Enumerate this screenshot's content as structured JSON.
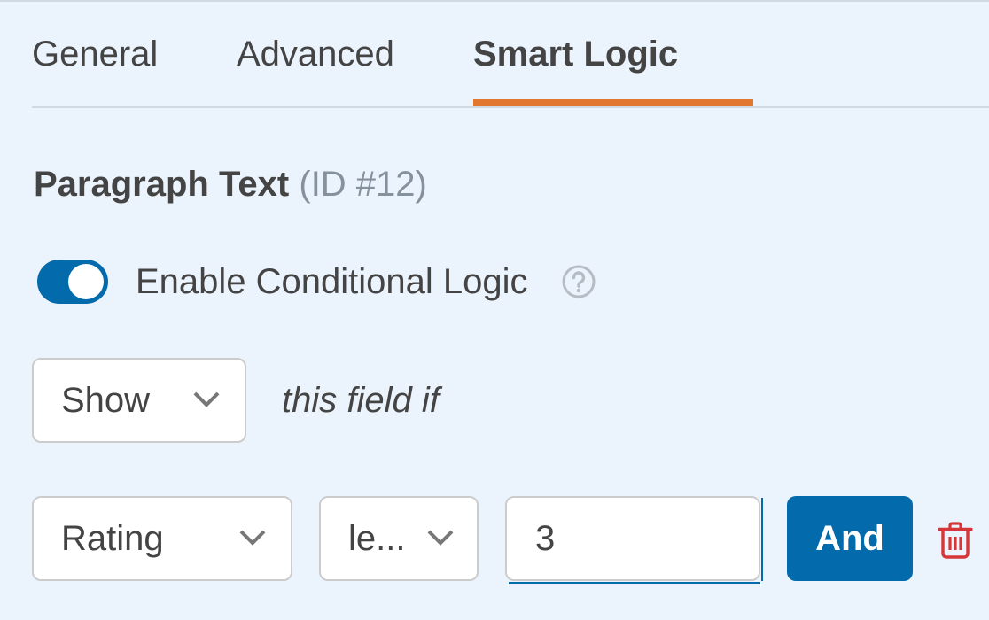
{
  "tabs": [
    {
      "label": "General",
      "active": false
    },
    {
      "label": "Advanced",
      "active": false
    },
    {
      "label": "Smart Logic",
      "active": true
    }
  ],
  "colors": {
    "accent_tab": "#e27730",
    "primary": "#036aab",
    "danger": "#d63638",
    "background": "#ebf3fc"
  },
  "field": {
    "name": "Paragraph Text",
    "id_label": "(ID #12)"
  },
  "conditional_logic": {
    "toggle_label": "Enable Conditional Logic",
    "enabled": true,
    "help_icon": "question-circle-icon"
  },
  "action": {
    "selected": "Show",
    "suffix": "this field if"
  },
  "rule": {
    "field_selected": "Rating",
    "operator_selected": "le...",
    "value": "3",
    "and_label": "And",
    "delete_icon": "trash-icon"
  }
}
